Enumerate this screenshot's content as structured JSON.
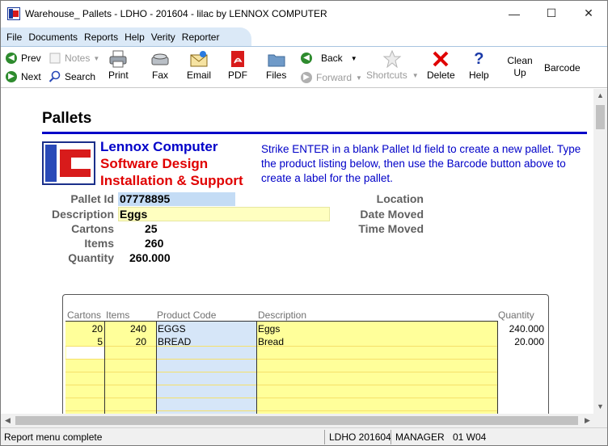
{
  "window": {
    "title": "Warehouse_ Pallets - LDHO - 201604 - lilac by LENNOX COMPUTER",
    "minimize": "—",
    "maximize": "☐",
    "close": "✕"
  },
  "menu": [
    "File",
    "Documents",
    "Reports",
    "Help",
    "Verity",
    "Reporter"
  ],
  "toolbar": {
    "prev": "Prev",
    "next": "Next",
    "notes": "Notes",
    "search": "Search",
    "print": "Print",
    "fax": "Fax",
    "email": "Email",
    "pdf": "PDF",
    "files": "Files",
    "back": "Back",
    "forward": "Forward",
    "shortcuts": "Shortcuts",
    "delete": "Delete",
    "help": "Help",
    "cleanup": "Clean Up",
    "barcode": "Barcode"
  },
  "page": {
    "heading": "Pallets",
    "company_line1": "Lennox Computer",
    "company_line2": "Software Design",
    "company_line3": "Installation & Support",
    "instructions": "Strike ENTER in a blank Pallet Id field to create a new pallet. Type the product listing below, then use the Barcode button above to create a label for the pallet."
  },
  "fields": {
    "pallet_id_label": "Pallet Id",
    "pallet_id": "07778895",
    "description_label": "Description",
    "description": "Eggs",
    "cartons_label": "Cartons",
    "cartons": "25",
    "items_label": "Items",
    "items": "260",
    "quantity_label": "Quantity",
    "quantity": "260.000",
    "location_label": "Location",
    "date_moved_label": "Date Moved",
    "time_moved_label": "Time Moved"
  },
  "grid": {
    "headers": {
      "cartons": "Cartons",
      "items": "Items",
      "product_code": "Product Code",
      "description": "Description",
      "quantity": "Quantity"
    },
    "rows": [
      {
        "cartons": "20",
        "items": "240",
        "product_code": "EGGS",
        "description": "Eggs",
        "quantity": "240.000"
      },
      {
        "cartons": "5",
        "items": "20",
        "product_code": "BREAD",
        "description": "Bread",
        "quantity": "20.000"
      }
    ]
  },
  "status": {
    "message": "Report menu complete",
    "company": "LDHO 201604",
    "user": "MANAGER",
    "station": "01 W04"
  },
  "colors": {
    "accent_blue": "#0000c8",
    "accent_red": "#e00000",
    "field_blue": "#c4dcf5",
    "field_yellow": "#ffffc0"
  }
}
